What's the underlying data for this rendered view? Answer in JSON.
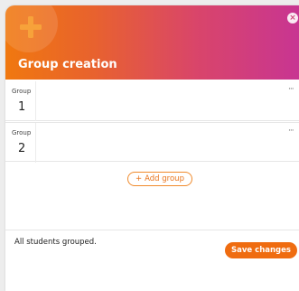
{
  "dialog": {
    "title": "Group creation",
    "close_icon": "close-icon",
    "close_symbol": "×",
    "header_icon": "plus-icon",
    "accent_color": "#ef6c10",
    "gradient": [
      "#f0780f",
      "#c83592"
    ]
  },
  "groups": [
    {
      "label": "Group",
      "number": "1",
      "menu": "···"
    },
    {
      "label": "Group",
      "number": "2",
      "menu": "···"
    }
  ],
  "add_group": {
    "icon": "+",
    "label": "Add group"
  },
  "status": {
    "text": "All students grouped."
  },
  "footer": {
    "save_label": "Save changes"
  }
}
